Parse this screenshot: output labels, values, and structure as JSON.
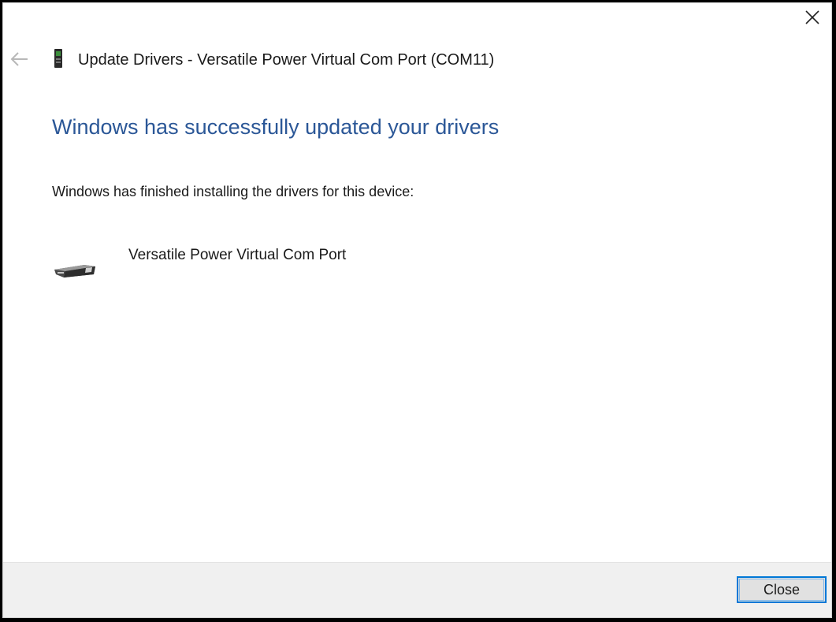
{
  "window": {
    "header_title": "Update Drivers - Versatile Power Virtual Com Port (COM11)"
  },
  "content": {
    "heading": "Windows has successfully updated your drivers",
    "info_text": "Windows has finished installing the drivers for this device:",
    "device_name": "Versatile Power Virtual Com Port"
  },
  "footer": {
    "close_label": "Close"
  },
  "colors": {
    "heading": "#2b5797",
    "button_border": "#0078d7",
    "footer_bg": "#f0f0f0"
  },
  "icons": {
    "close": "close-icon",
    "back": "back-arrow-icon",
    "device_small": "device-manager-icon",
    "device": "serial-port-icon"
  }
}
